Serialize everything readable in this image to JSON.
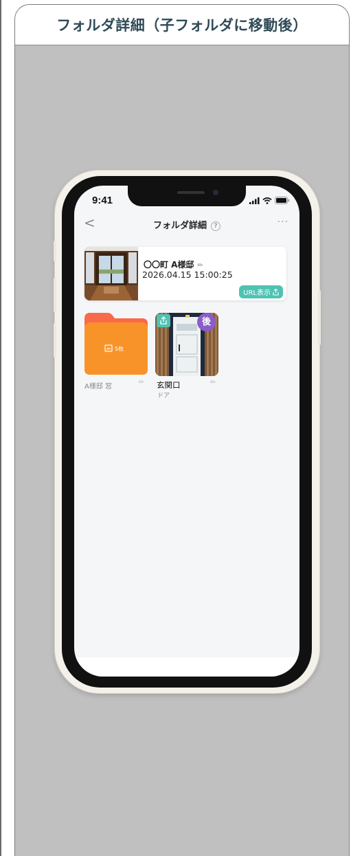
{
  "slide": {
    "title": "フォルダ詳細（子フォルダに移動後）"
  },
  "status_bar": {
    "time": "9:41"
  },
  "nav": {
    "title": "フォルダ詳細",
    "help_icon": "question-circle-icon",
    "back_icon": "chevron-left-icon",
    "more_icon": "ellipsis-icon",
    "more_text": "···",
    "back_text": "<",
    "help_text": "?"
  },
  "main_item": {
    "name": "〇〇町 A様邸",
    "date": "2026.04.15 15:00:25",
    "url_button": "URL表示",
    "edit_icon": "pencil-icon"
  },
  "folder": {
    "count": "5枚",
    "label": "A様邸 窓",
    "color_back": "#f86a4a",
    "color_front": "#f8932a"
  },
  "photo": {
    "badge": "後",
    "label": "玄関口",
    "sub": "ドア",
    "share_icon": "share-icon"
  },
  "colors": {
    "accent": "#4fc3b3",
    "after_badge": "#8a5dc8",
    "header_text": "#2f4a56",
    "background": "#c0c0c0"
  }
}
